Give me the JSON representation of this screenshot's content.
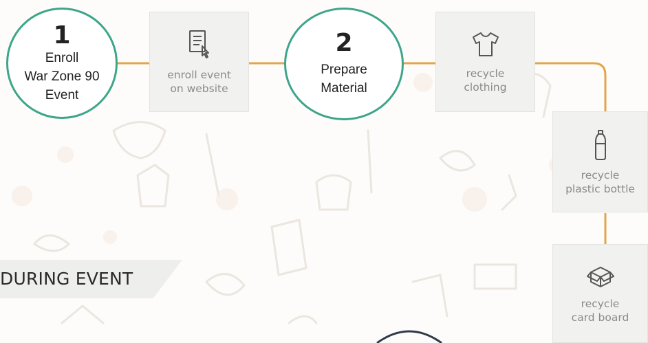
{
  "steps": [
    {
      "number": "1",
      "lines": [
        "Enroll",
        "War Zone 90",
        "Event"
      ]
    },
    {
      "number": "2",
      "lines": [
        "Prepare",
        "Material"
      ]
    }
  ],
  "cards": [
    {
      "icon": "document-cursor-icon",
      "lines": [
        "enroll event",
        "on website"
      ]
    },
    {
      "icon": "t-shirt-icon",
      "lines": [
        "recycle",
        "clothing"
      ]
    },
    {
      "icon": "plastic-bottle-icon",
      "lines": [
        "recycle",
        "plastic bottle"
      ]
    },
    {
      "icon": "cardboard-box-icon",
      "lines": [
        "recycle",
        "card board"
      ]
    }
  ],
  "section": {
    "title": "DURING EVENT"
  },
  "colors": {
    "accent_green": "#3ea58a",
    "connector_orange": "#e3a54c",
    "card_bg": "#f1f1f0",
    "banner_bg": "#eeeeed",
    "dark_circle": "#2f3a4a"
  }
}
